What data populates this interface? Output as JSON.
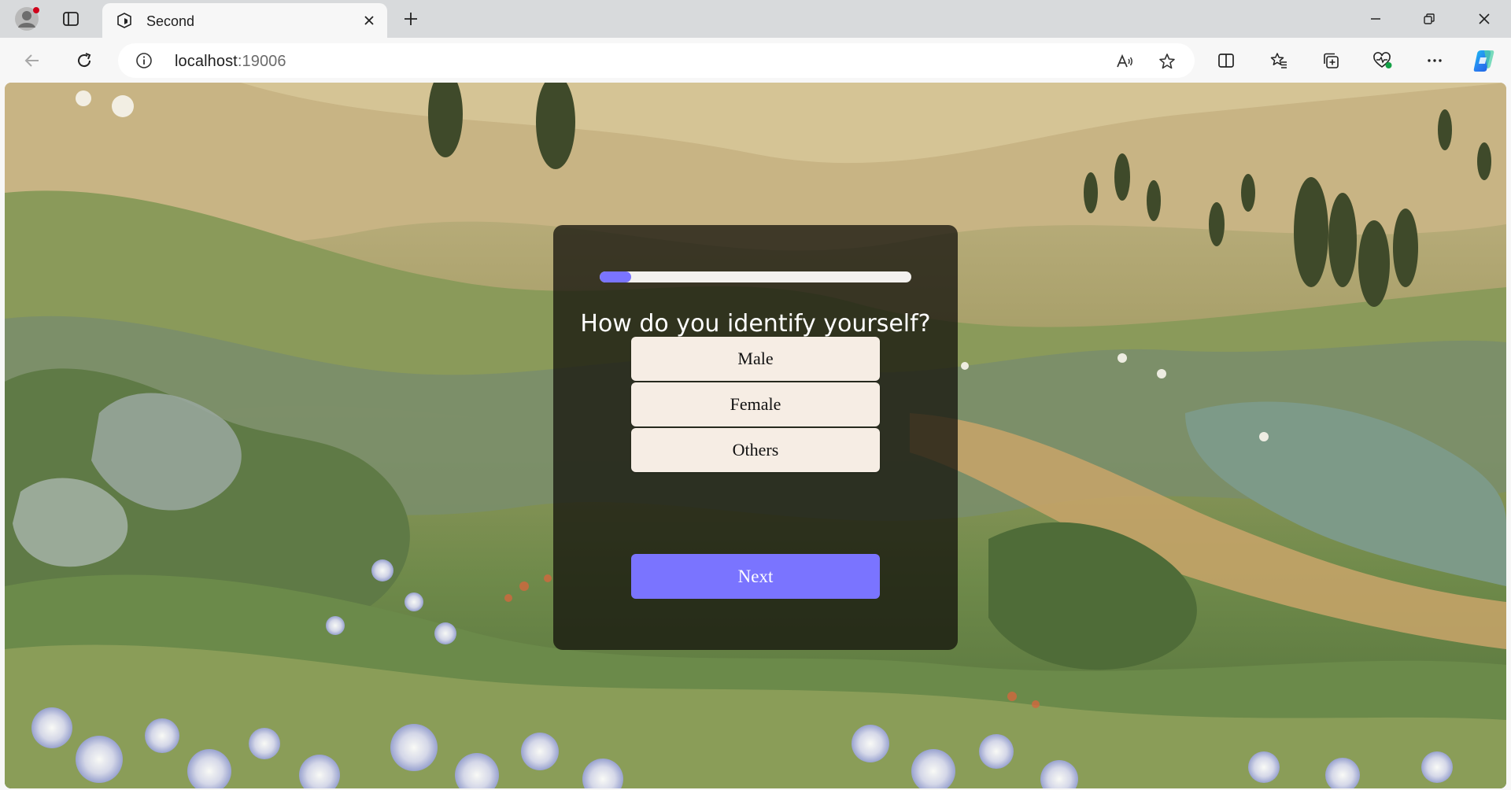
{
  "browser": {
    "tab": {
      "title": "Second"
    },
    "address": {
      "host": "localhost",
      "port": ":19006"
    },
    "icons": {
      "profile": "profile-avatar-icon",
      "workspaces": "tab-actions-icon",
      "favicon": "expo-favicon-icon",
      "close": "close-icon",
      "new_tab": "plus-icon",
      "back": "back-arrow-icon",
      "refresh": "refresh-icon",
      "info": "info-icon",
      "read_aloud": "read-aloud-icon",
      "favorite": "star-icon",
      "split": "split-screen-icon",
      "favorites": "favorites-icon",
      "collections": "collections-icon",
      "health": "browser-essentials-icon",
      "more": "more-icon",
      "copilot": "copilot-icon"
    }
  },
  "quiz": {
    "progress": 0.1,
    "question": "How do you identify yourself?",
    "options": [
      "Male",
      "Female",
      "Others"
    ],
    "next_label": "Next"
  },
  "colors": {
    "accent": "#7a74ff",
    "option_bg": "#f6ede4",
    "card_bg": "rgba(20,18,12,0.76)"
  }
}
